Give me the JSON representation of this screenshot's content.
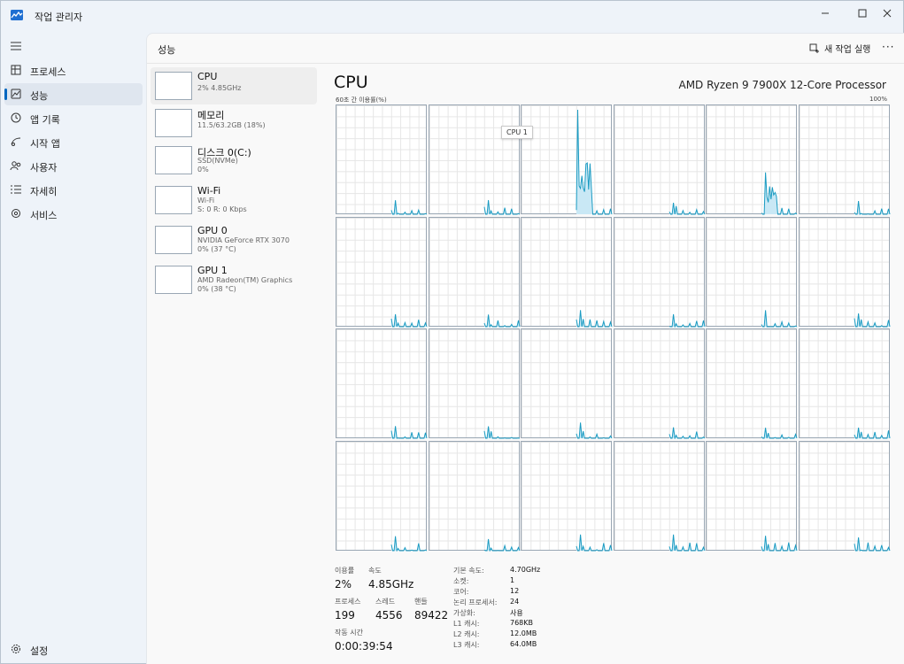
{
  "window": {
    "title": "작업 관리자"
  },
  "nav": {
    "items": [
      {
        "label": "프로세스",
        "icon": "processes-icon",
        "active": false
      },
      {
        "label": "성능",
        "icon": "performance-icon",
        "active": true
      },
      {
        "label": "앱 기록",
        "icon": "app-history-icon",
        "active": false
      },
      {
        "label": "시작 앱",
        "icon": "startup-apps-icon",
        "active": false
      },
      {
        "label": "사용자",
        "icon": "users-icon",
        "active": false
      },
      {
        "label": "자세히",
        "icon": "details-icon",
        "active": false
      },
      {
        "label": "서비스",
        "icon": "services-icon",
        "active": false
      }
    ],
    "settings_label": "설정"
  },
  "header": {
    "title": "성능",
    "run_task_label": "새 작업 실행",
    "more_label": "···"
  },
  "devices": [
    {
      "name": "CPU",
      "lines": [
        "2% 4.85GHz"
      ]
    },
    {
      "name": "메모리",
      "lines": [
        "11.5/63.2GB (18%)"
      ]
    },
    {
      "name": "디스크 0(C:)",
      "lines": [
        "SSD(NVMe)",
        "0%"
      ]
    },
    {
      "name": "Wi-Fi",
      "lines": [
        "Wi-Fi",
        "S: 0  R: 0 Kbps"
      ]
    },
    {
      "name": "GPU 0",
      "lines": [
        "NVIDIA GeForce RTX 3070",
        "0% (37 °C)"
      ]
    },
    {
      "name": "GPU 1",
      "lines": [
        "AMD Radeon(TM) Graphics",
        "0% (38 °C)"
      ]
    }
  ],
  "cpu": {
    "title": "CPU",
    "model": "AMD Ryzen 9 7900X 12-Core Processor",
    "graph_caption": "60초 간 이용률(%)",
    "graph_max": "100%",
    "tooltip": "CPU 1"
  },
  "stats": {
    "util_label": "이용률",
    "util_value": "2%",
    "speed_label": "속도",
    "speed_value": "4.85GHz",
    "proc_label": "프로세스",
    "proc_value": "199",
    "thread_label": "스레드",
    "thread_value": "4556",
    "handle_label": "핸들",
    "handle_value": "89422",
    "uptime_label": "작동 시간",
    "uptime_value": "0:00:39:54"
  },
  "specs": [
    {
      "k": "기본 속도:",
      "v": "4.70GHz"
    },
    {
      "k": "소켓:",
      "v": "1"
    },
    {
      "k": "코어:",
      "v": "12"
    },
    {
      "k": "논리 프로세서:",
      "v": "24"
    },
    {
      "k": "가상화:",
      "v": "사용"
    },
    {
      "k": "L1 캐시:",
      "v": "768KB"
    },
    {
      "k": "L2 캐시:",
      "v": "12.0MB"
    },
    {
      "k": "L3 캐시:",
      "v": "64.0MB"
    }
  ],
  "colors": {
    "accent": "#0067c0",
    "graph_line": "#1a9bc2",
    "graph_fill": "#c9e8f5"
  }
}
